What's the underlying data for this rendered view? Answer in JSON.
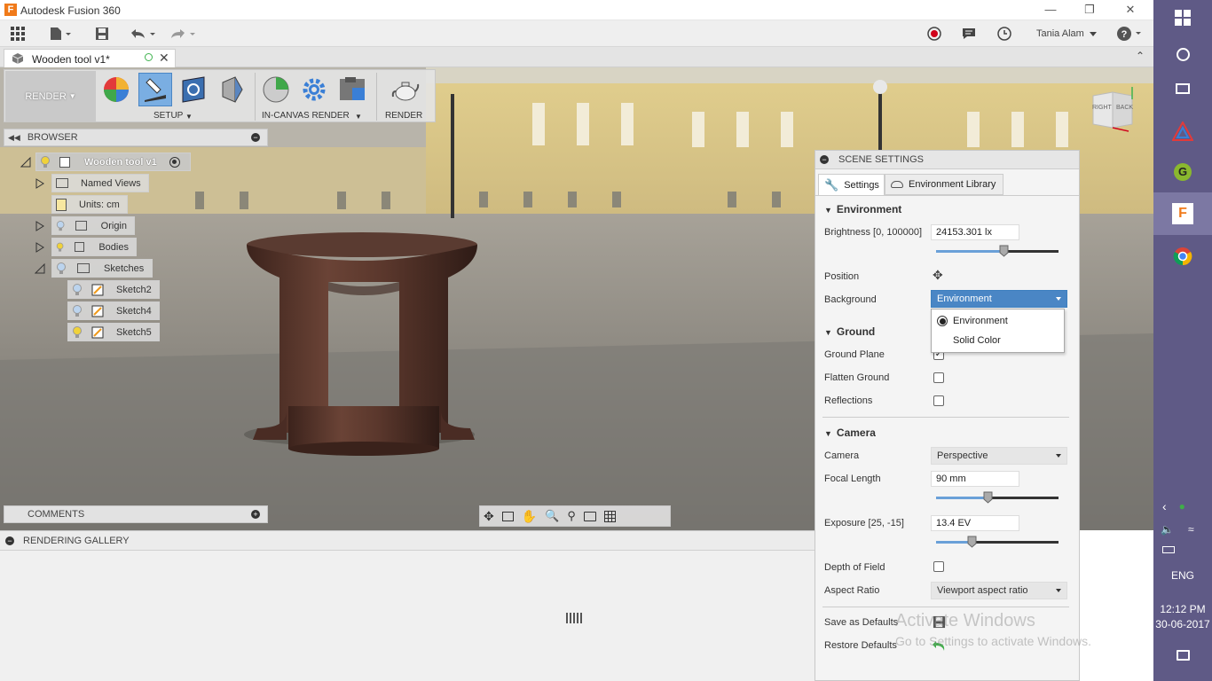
{
  "app": {
    "title": "Autodesk Fusion 360",
    "user": "Tania Alam"
  },
  "doc_tab": {
    "name": "Wooden tool v1*"
  },
  "toolbar": {
    "workspace": "RENDER",
    "setup": "SETUP",
    "in_canvas": "IN-CANVAS RENDER",
    "render": "RENDER"
  },
  "browser": {
    "title": "BROWSER",
    "root": "Wooden tool v1",
    "items": [
      {
        "label": "Named Views"
      },
      {
        "label": "Units: cm"
      },
      {
        "label": "Origin"
      },
      {
        "label": "Bodies"
      },
      {
        "label": "Sketches"
      },
      {
        "label": "Sketch2"
      },
      {
        "label": "Sketch4"
      },
      {
        "label": "Sketch5"
      }
    ]
  },
  "comments": {
    "title": "COMMENTS"
  },
  "gallery": {
    "title": "RENDERING GALLERY"
  },
  "viewcube": {
    "right": "RIGHT",
    "back": "BACK"
  },
  "scene": {
    "title": "SCENE SETTINGS",
    "tabs": [
      "Settings",
      "Environment Library"
    ],
    "environment": {
      "heading": "Environment",
      "brightness_label": "Brightness [0, 100000]",
      "brightness_value": "24153.301 lx",
      "brightness_level": 0.55,
      "position_label": "Position",
      "background_label": "Background",
      "background_value": "Environment",
      "background_options": [
        "Environment",
        "Solid Color"
      ]
    },
    "ground": {
      "heading": "Ground",
      "ground_plane": "Ground Plane",
      "flatten_ground": "Flatten Ground",
      "reflections": "Reflections"
    },
    "camera": {
      "heading": "Camera",
      "camera_label": "Camera",
      "camera_value": "Perspective",
      "focal_label": "Focal Length",
      "focal_value": "90 mm",
      "focal_level": 0.42,
      "exposure_label": "Exposure [25, -15]",
      "exposure_value": "13.4 EV",
      "exposure_level": 0.29,
      "dof_label": "Depth of Field",
      "aspect_label": "Aspect Ratio",
      "aspect_value": "Viewport aspect ratio"
    },
    "save_defaults": "Save as Defaults",
    "restore_defaults": "Restore Defaults"
  },
  "watermark": {
    "line1": "Activate Windows",
    "line2": "Go to Settings to activate Windows."
  },
  "taskbar": {
    "lang": "ENG",
    "time": "12:12 PM",
    "date": "30-06-2017"
  },
  "colors": {
    "accent": "#4a86c5",
    "taskbar": "#5f5a86",
    "selection": "#3d7fbf"
  }
}
